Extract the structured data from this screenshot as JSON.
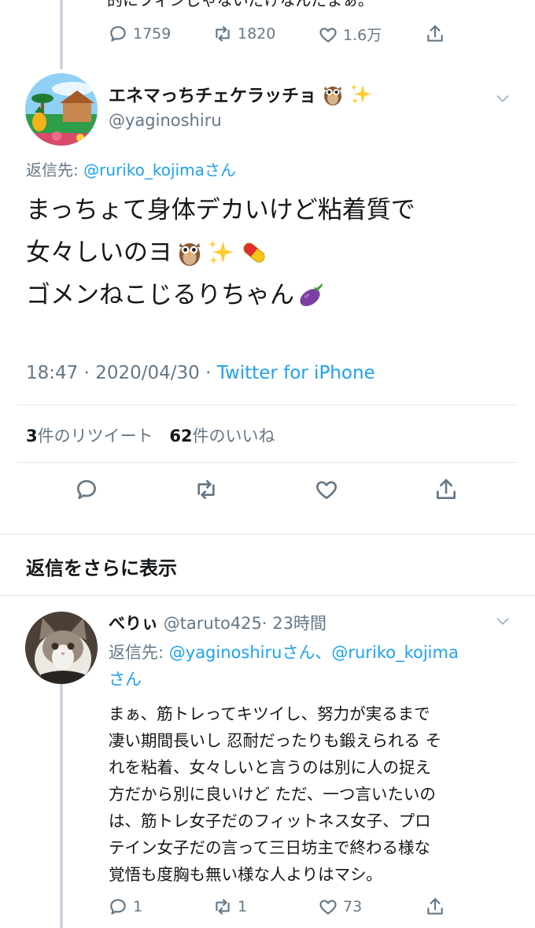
{
  "prev_tweet": {
    "cut_text": "的にフィンじゃないだけなんだまぁ。",
    "replies": "1759",
    "retweets": "1820",
    "likes": "1.6万"
  },
  "main_tweet": {
    "display_name": "エネマっちチェケラッチョ",
    "handle": "@yaginoshiru",
    "reply_prefix": "返信先: ",
    "reply_to": "@ruriko_kojimaさん",
    "lines": [
      "まっちょて身体デカいけど粘着質で",
      "女々しいのヨ",
      "ゴメンねこじるりちゃん"
    ],
    "time": "18:47 · 2020/04/30 · ",
    "source": "Twitter for iPhone",
    "retweet_count": "3",
    "retweet_label": "件のリツイート",
    "like_count": "62",
    "like_label": "件のいいね"
  },
  "more_replies": {
    "title": "返信をさらに表示"
  },
  "reply_tweet": {
    "display_name": "べりぃ",
    "handle": "@taruto425",
    "time": "· 23時間",
    "reply_prefix": "返信先: ",
    "reply_to_1": "@yaginoshiruさん、@ruriko_kojima",
    "reply_to_2": "さん",
    "lines": [
      "まぁ、筋トレってキツイし、努力が実るまで",
      "凄い期間長いし 忍耐だったりも鍛えられる そ",
      "れを粘着、女々しいと言うのは別に人の捉え",
      "方だから別に良いけど ただ、一つ言いたいの",
      "は、筋トレ女子だのフィットネス女子、プロ",
      "テイン女子だの言って三日坊主で終わる様な",
      "覚悟も度胸も無い様な人よりはマシ。"
    ],
    "replies": "1",
    "retweets": "1",
    "likes": "73"
  },
  "colors": {
    "link": "#1da1f2",
    "muted": "#657786",
    "divider": "#e1e8ed"
  },
  "icons": [
    "reply-icon",
    "retweet-icon",
    "like-icon",
    "share-icon",
    "chevron-down-icon",
    "owl-emoji",
    "sparkles-emoji",
    "pill-emoji",
    "eggplant-emoji"
  ]
}
